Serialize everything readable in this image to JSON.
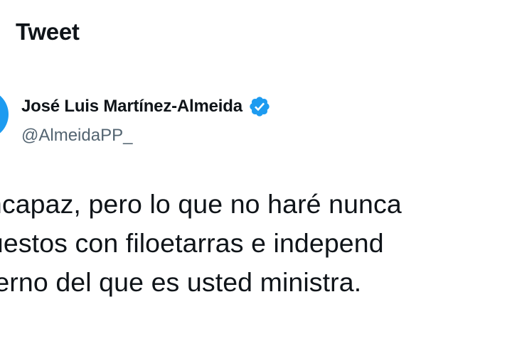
{
  "header": {
    "title": "Tweet"
  },
  "author": {
    "name": "José Luis Martínez-Almeida",
    "handle": "@AlmeidaPP_",
    "verified_icon": "verified-badge-icon",
    "accent_color": "#1d9bf0"
  },
  "tweet": {
    "lines": [
      "e incapaz, pero lo que no haré nunca",
      "upuestos con filoetarras e independ",
      "obierno del que es usted ministra."
    ]
  },
  "colors": {
    "text": "#0f1419",
    "secondary_text": "#536471",
    "background": "#ffffff"
  }
}
